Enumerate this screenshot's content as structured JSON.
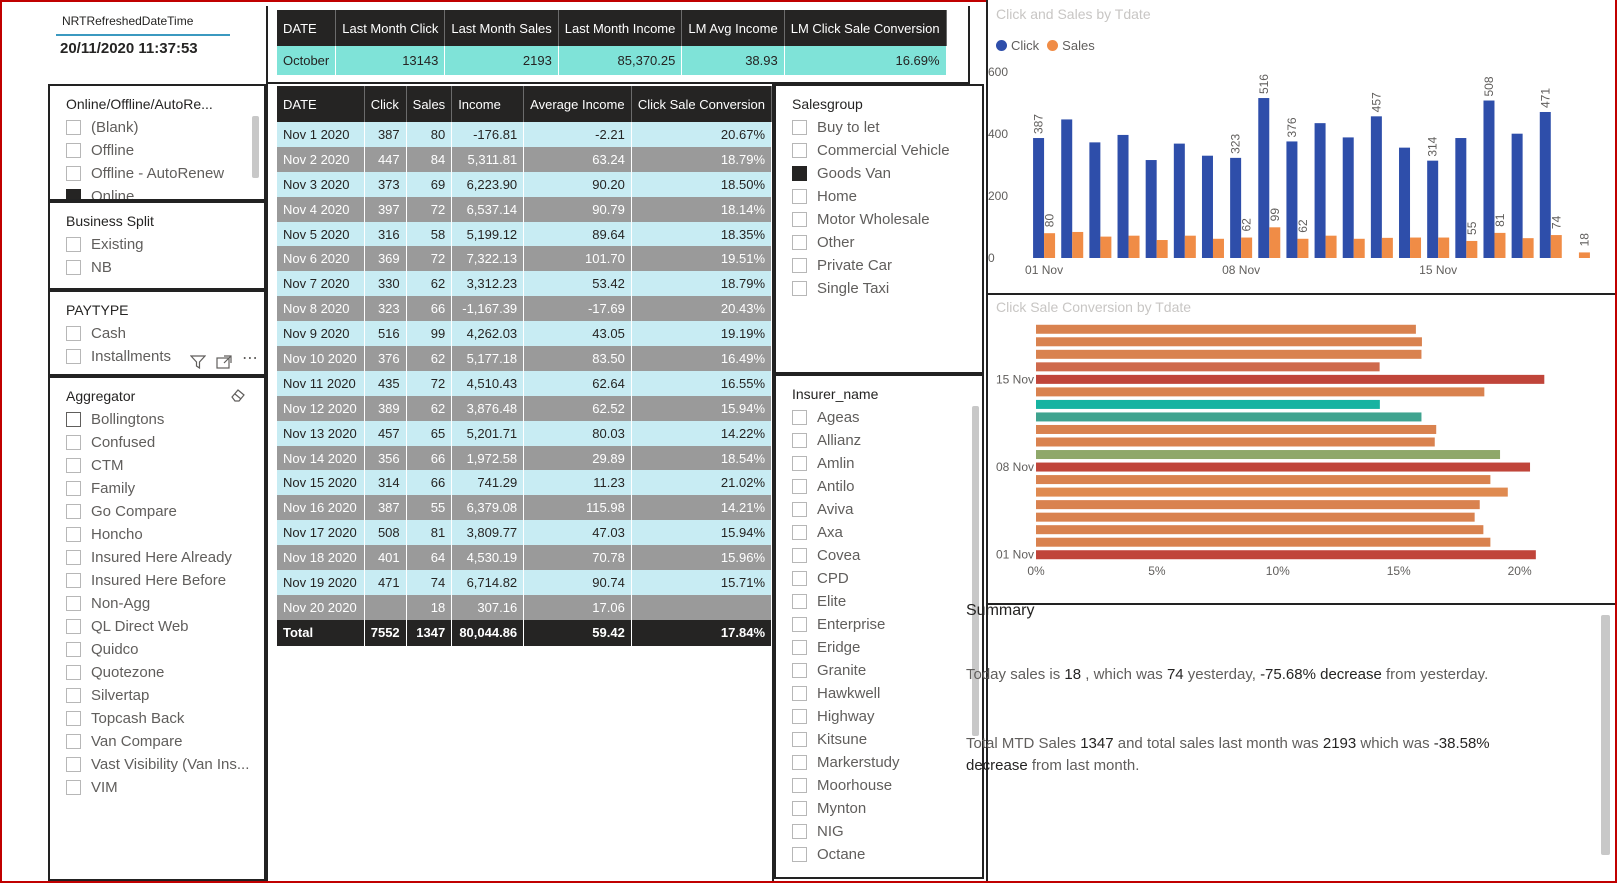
{
  "refresh": {
    "label": "NRTRefreshedDateTime",
    "value": "20/11/2020 11:37:53"
  },
  "slicer_online": {
    "title": "Online/Offline/AutoRe...",
    "items": [
      {
        "label": "(Blank)",
        "checked": false
      },
      {
        "label": "Offline",
        "checked": false
      },
      {
        "label": "Offline - AutoRenew",
        "checked": false
      },
      {
        "label": "Online",
        "checked": true
      }
    ]
  },
  "slicer_business": {
    "title": "Business Split",
    "items": [
      {
        "label": "Existing",
        "checked": false
      },
      {
        "label": "NB",
        "checked": false
      }
    ]
  },
  "slicer_paytype": {
    "title": "PAYTYPE",
    "items": [
      {
        "label": "Cash",
        "checked": false
      },
      {
        "label": "Installments",
        "checked": false
      }
    ]
  },
  "slicer_aggregator": {
    "title": "Aggregator",
    "items": [
      "Bollingtons",
      "Confused",
      "CTM",
      "Family",
      "Go Compare",
      "Honcho",
      "Insured Here Already",
      "Insured Here Before",
      "Non-Agg",
      "QL Direct Web",
      "Quidco",
      "Quotezone",
      "Silvertap",
      "Topcash Back",
      "Van Compare",
      "Vast Visibility (Van Ins...",
      "VIM"
    ]
  },
  "slicer_salesgroup": {
    "title": "Salesgroup",
    "items": [
      {
        "label": "Buy to let",
        "checked": false
      },
      {
        "label": "Commercial Vehicle",
        "checked": false
      },
      {
        "label": "Goods Van",
        "checked": true
      },
      {
        "label": "Home",
        "checked": false
      },
      {
        "label": "Motor Wholesale",
        "checked": false
      },
      {
        "label": "Other",
        "checked": false
      },
      {
        "label": "Private Car",
        "checked": false
      },
      {
        "label": "Single Taxi",
        "checked": false
      }
    ]
  },
  "slicer_insurer": {
    "title": "Insurer_name",
    "items": [
      "Ageas",
      "Allianz",
      "Amlin",
      "Antilo",
      "Aviva",
      "Axa",
      "Covea",
      "CPD",
      "Elite",
      "Enterprise",
      "Eridge",
      "Granite",
      "Hawkwell",
      "Highway",
      "Kitsune",
      "Markerstudy",
      "Moorhouse",
      "Mynton",
      "NIG",
      "Octane"
    ]
  },
  "lm_table": {
    "headers": [
      "DATE",
      "Last Month Click",
      "Last Month Sales",
      "Last Month Income",
      "LM Avg Income",
      "LM Click Sale Conversion"
    ],
    "row": [
      "October",
      "13143",
      "2193",
      "85,370.25",
      "38.93",
      "16.69%"
    ]
  },
  "daily_table": {
    "headers": [
      "DATE",
      "Click",
      "Sales",
      "Income",
      "Average Income",
      "Click Sale Conversion"
    ],
    "rows": [
      [
        "Nov 1 2020",
        "387",
        "80",
        "-176.81",
        "-2.21",
        "20.67%"
      ],
      [
        "Nov 2 2020",
        "447",
        "84",
        "5,311.81",
        "63.24",
        "18.79%"
      ],
      [
        "Nov 3 2020",
        "373",
        "69",
        "6,223.90",
        "90.20",
        "18.50%"
      ],
      [
        "Nov 4 2020",
        "397",
        "72",
        "6,537.14",
        "90.79",
        "18.14%"
      ],
      [
        "Nov 5 2020",
        "316",
        "58",
        "5,199.12",
        "89.64",
        "18.35%"
      ],
      [
        "Nov 6 2020",
        "369",
        "72",
        "7,322.13",
        "101.70",
        "19.51%"
      ],
      [
        "Nov 7 2020",
        "330",
        "62",
        "3,312.23",
        "53.42",
        "18.79%"
      ],
      [
        "Nov 8 2020",
        "323",
        "66",
        "-1,167.39",
        "-17.69",
        "20.43%"
      ],
      [
        "Nov 9 2020",
        "516",
        "99",
        "4,262.03",
        "43.05",
        "19.19%"
      ],
      [
        "Nov 10 2020",
        "376",
        "62",
        "5,177.18",
        "83.50",
        "16.49%"
      ],
      [
        "Nov 11 2020",
        "435",
        "72",
        "4,510.43",
        "62.64",
        "16.55%"
      ],
      [
        "Nov 12 2020",
        "389",
        "62",
        "3,876.48",
        "62.52",
        "15.94%"
      ],
      [
        "Nov 13 2020",
        "457",
        "65",
        "5,201.71",
        "80.03",
        "14.22%"
      ],
      [
        "Nov 14 2020",
        "356",
        "66",
        "1,972.58",
        "29.89",
        "18.54%"
      ],
      [
        "Nov 15 2020",
        "314",
        "66",
        "741.29",
        "11.23",
        "21.02%"
      ],
      [
        "Nov 16 2020",
        "387",
        "55",
        "6,379.08",
        "115.98",
        "14.21%"
      ],
      [
        "Nov 17 2020",
        "508",
        "81",
        "3,809.77",
        "47.03",
        "15.94%"
      ],
      [
        "Nov 18 2020",
        "401",
        "64",
        "4,530.19",
        "70.78",
        "15.96%"
      ],
      [
        "Nov 19 2020",
        "471",
        "74",
        "6,714.82",
        "90.74",
        "15.71%"
      ],
      [
        "Nov 20 2020",
        "",
        "18",
        "307.16",
        "17.06",
        ""
      ]
    ],
    "total": [
      "Total",
      "7552",
      "1347",
      "80,044.86",
      "59.42",
      "17.84%"
    ]
  },
  "chart_data": [
    {
      "type": "bar",
      "title": "Click and Sales by Tdate",
      "categories": [
        "01 Nov",
        "02 Nov",
        "03 Nov",
        "04 Nov",
        "05 Nov",
        "06 Nov",
        "07 Nov",
        "08 Nov",
        "09 Nov",
        "10 Nov",
        "11 Nov",
        "12 Nov",
        "13 Nov",
        "14 Nov",
        "15 Nov",
        "16 Nov",
        "17 Nov",
        "18 Nov",
        "19 Nov",
        "20 Nov"
      ],
      "x_tick_labels": [
        "01 Nov",
        "08 Nov",
        "15 Nov"
      ],
      "series": [
        {
          "name": "Click",
          "color": "#2e4eaa",
          "values": [
            387,
            447,
            373,
            397,
            316,
            369,
            330,
            323,
            516,
            376,
            435,
            389,
            457,
            356,
            314,
            387,
            508,
            401,
            471,
            0
          ]
        },
        {
          "name": "Sales",
          "color": "#f08c46",
          "values": [
            80,
            84,
            69,
            72,
            58,
            72,
            62,
            66,
            99,
            62,
            72,
            62,
            65,
            66,
            66,
            55,
            81,
            64,
            74,
            18
          ]
        }
      ],
      "click_labels": {
        "0": "387",
        "7": "323",
        "8": "516",
        "9": "376",
        "12": "457",
        "14": "314",
        "16": "508",
        "18": "471"
      },
      "sales_labels": {
        "0": "80",
        "7": "62",
        "8": "99",
        "9": "62",
        "15": "55",
        "16": "81",
        "18": "74",
        "19": "18"
      },
      "y_ticks": [
        "0",
        "200",
        "400",
        "600"
      ],
      "ylim": [
        0,
        600
      ],
      "legend": "top-left"
    },
    {
      "type": "bar",
      "orientation": "horizontal",
      "title": "Click Sale Conversion by Tdate",
      "categories": [
        "01 Nov",
        "02 Nov",
        "03 Nov",
        "04 Nov",
        "05 Nov",
        "06 Nov",
        "07 Nov",
        "08 Nov",
        "09 Nov",
        "10 Nov",
        "11 Nov",
        "12 Nov",
        "13 Nov",
        "14 Nov",
        "15 Nov",
        "16 Nov",
        "17 Nov",
        "18 Nov",
        "19 Nov"
      ],
      "y_tick_labels": [
        "01 Nov",
        "08 Nov",
        "15 Nov"
      ],
      "values": [
        20.67,
        18.79,
        18.5,
        18.14,
        18.35,
        19.51,
        18.79,
        20.43,
        19.19,
        16.49,
        16.55,
        15.94,
        14.22,
        18.54,
        21.02,
        14.21,
        15.94,
        15.96,
        15.71
      ],
      "colors": [
        "#c0453a",
        "#d9824f",
        "#d9824f",
        "#d9824f",
        "#d9824f",
        "#df8a50",
        "#d9824f",
        "#c0453a",
        "#8fa86a",
        "#d9824f",
        "#d9824f",
        "#3fa38f",
        "#17b3a1",
        "#d9824f",
        "#c0453a",
        "#cf6a4c",
        "#d9824f",
        "#d9824f",
        "#d9824f"
      ],
      "x_ticks": [
        "0%",
        "5%",
        "10%",
        "15%",
        "20%"
      ],
      "xlim": [
        0,
        22
      ]
    }
  ],
  "summary": {
    "title": "Summary",
    "line1": [
      {
        "t": "Today sales is ",
        "b": false
      },
      {
        "t": "18",
        "b": true
      },
      {
        "t": " , which was ",
        "b": false
      },
      {
        "t": "74",
        "b": true
      },
      {
        "t": " yesterday, ",
        "b": false
      },
      {
        "t": "-75.68% decrease",
        "b": true
      },
      {
        "t": " from yesterday.",
        "b": false
      }
    ],
    "line2": [
      {
        "t": "Total MTD Sales ",
        "b": false
      },
      {
        "t": "1347",
        "b": true
      },
      {
        "t": " and total sales last month was ",
        "b": false
      },
      {
        "t": "2193",
        "b": true
      },
      {
        "t": " which was ",
        "b": false
      },
      {
        "t": "-38.58% decrease",
        "b": true
      },
      {
        "t": " from last month.",
        "b": false
      }
    ]
  }
}
